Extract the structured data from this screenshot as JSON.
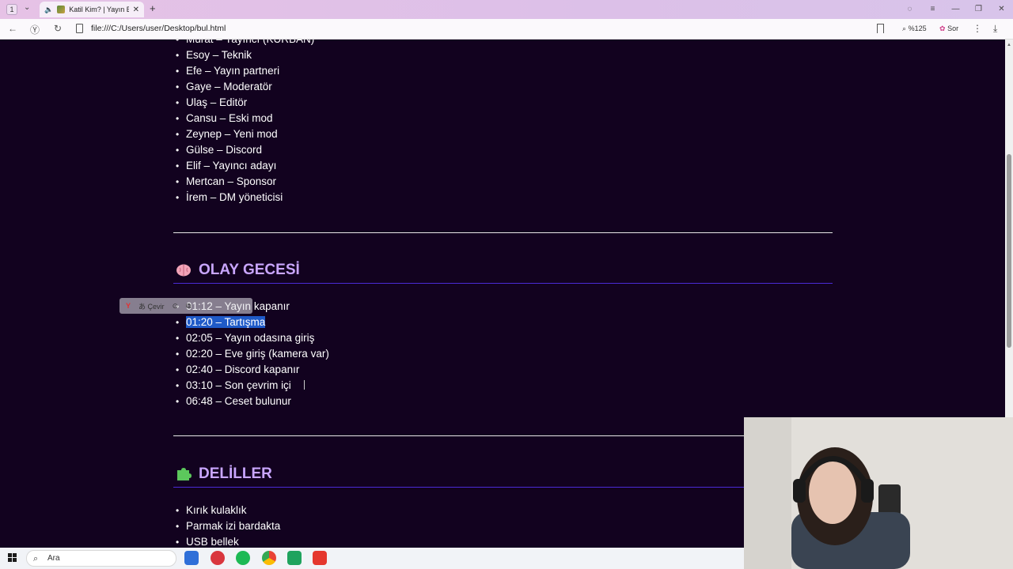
{
  "browser": {
    "tab_count": "1",
    "tab_title": "Katil Kim? | Yayın Bi",
    "url": "file:///C:/Users/user/Desktop/bul.html",
    "zoom": "%125",
    "ask_label": "Sor"
  },
  "page": {
    "partial_top_item": "Murat – Yayıncı (KURBAN)",
    "people": [
      "Esoy – Teknik",
      "Efe – Yayın partneri",
      "Gaye – Moderatör",
      "Ulaş – Editör",
      "Cansu – Eski mod",
      "Zeynep – Yeni mod",
      "Gülse – Discord",
      "Elif – Yayıncı adayı",
      "Mertcan – Sponsor",
      "İrem – DM yöneticisi"
    ],
    "section_night": {
      "title": "OLAY GECESİ",
      "items": [
        "01:12 – Yayın kapanır",
        "01:20 – Tartışma",
        "02:05 – Yayın odasına giriş",
        "02:20 – Eve giriş (kamera var)",
        "02:40 – Discord kapanır",
        "03:10 – Son çevrim içi",
        "06:48 – Ceset bulunur"
      ]
    },
    "section_evidence": {
      "title": "DELİLLER",
      "items": [
        "Kırık kulaklık",
        "Parmak izi bardakta",
        "USB bellek"
      ]
    }
  },
  "mini_toolbar": {
    "translate_label": "Çevir"
  },
  "taskbar": {
    "search_placeholder": "Ara"
  },
  "colors": {
    "page_bg": "#12021f",
    "section_title": "#c9a6ff",
    "section_rule": "#4a2bd6",
    "selection": "#1f5ac8"
  }
}
